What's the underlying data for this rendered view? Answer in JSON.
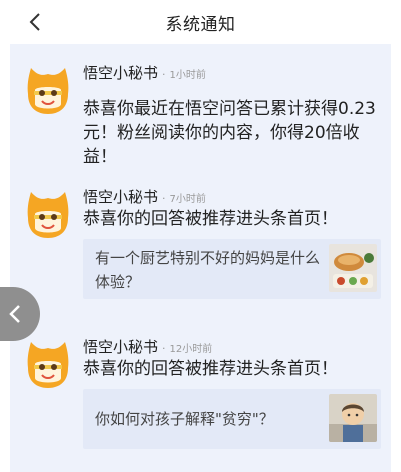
{
  "header": {
    "title": "系统通知"
  },
  "messages": [
    {
      "sender": "悟空小秘书",
      "separator": "·",
      "time": "1小时前",
      "text": "恭喜你最近在悟空问答已累计获得0.23元！粉丝阅读你的内容，你得20倍收益！"
    },
    {
      "sender": "悟空小秘书",
      "separator": "·",
      "time": "7小时前",
      "text": "恭喜你的回答被推荐进头条首页！",
      "quote": "有一个厨艺特别不好的妈妈是什么体验？"
    },
    {
      "sender": "悟空小秘书",
      "separator": "·",
      "time": "12小时前",
      "text": "恭喜你的回答被推荐进头条首页！",
      "quote": "你如何对孩子解释\"贫穷\"？"
    }
  ],
  "colors": {
    "feed_bg": "#eef2fb",
    "quote_bg": "#e3e9f7",
    "avatar_orange": "#f5a623",
    "side_button": "#8f8f8f"
  },
  "icons": {
    "back": "chevron-left-icon",
    "avatar": "wukong-monkey-avatar",
    "side": "chevron-left-icon"
  }
}
